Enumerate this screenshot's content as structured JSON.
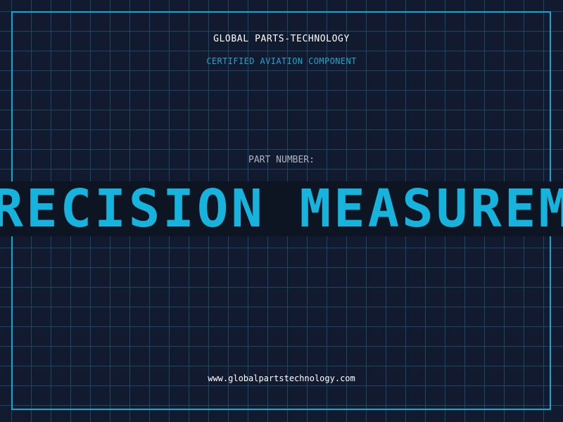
{
  "header": {
    "company": "GLOBAL PARTS-TECHNOLOGY",
    "tagline": "CERTIFIED AVIATION COMPONENT"
  },
  "part": {
    "label": "PART NUMBER:",
    "banner_text": "PRECISION MEASUREMENT TOOL"
  },
  "footer": {
    "url": "www.globalpartstechnology.com"
  },
  "colors": {
    "background": "#111a2e",
    "grid": "#1f4e68",
    "accent": "#16b4dc",
    "frame": "#12a9cf"
  }
}
